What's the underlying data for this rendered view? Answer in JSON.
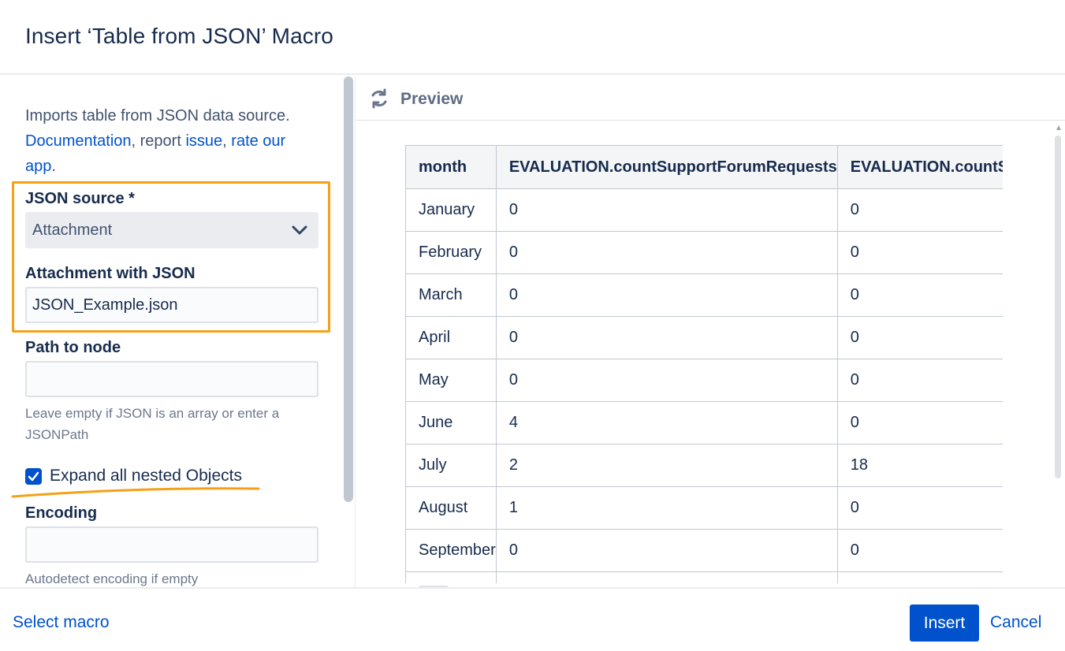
{
  "dialog": {
    "title": "Insert ‘Table from JSON’ Macro"
  },
  "left": {
    "intro_text": "Imports table from JSON data source.",
    "doc_link": "Documentation",
    "report_text": ", report ",
    "issue_link": "issue",
    "comma": ", ",
    "rate_link": "rate our app",
    "period": ".",
    "json_source_label": "JSON source *",
    "json_source_value": "Attachment",
    "attachment_label": "Attachment with JSON",
    "attachment_value": "JSON_Example.json",
    "path_label": "Path to node",
    "path_value": "",
    "path_help": "Leave empty if JSON is an array or enter a JSONPath",
    "expand_label": "Expand all nested Objects",
    "expand_checked": true,
    "encoding_label": "Encoding",
    "encoding_value": "",
    "encoding_help": "Autodetect encoding if empty"
  },
  "preview": {
    "title": "Preview",
    "columns": [
      "month",
      "EVALUATION.countSupportForumRequests",
      "EVALUATION.countSupportForumRequests"
    ],
    "rows": [
      [
        "January",
        "0",
        "0"
      ],
      [
        "February",
        "0",
        "0"
      ],
      [
        "March",
        "0",
        "0"
      ],
      [
        "April",
        "0",
        "0"
      ],
      [
        "May",
        "0",
        "0"
      ],
      [
        "June",
        "4",
        "0"
      ],
      [
        "July",
        "2",
        "18"
      ],
      [
        "August",
        "1",
        "0"
      ],
      [
        "September",
        "0",
        "0"
      ],
      [
        "",
        "",
        ""
      ]
    ]
  },
  "footer": {
    "select_macro": "Select macro",
    "insert": "Insert",
    "cancel": "Cancel"
  },
  "colors": {
    "primary": "#0052cc",
    "highlight": "#f6a018"
  }
}
